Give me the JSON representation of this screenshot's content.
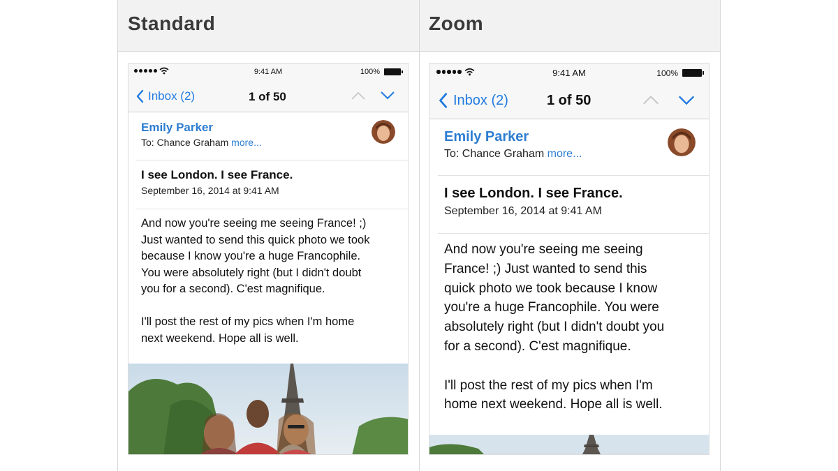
{
  "columns": {
    "standard_title": "Standard",
    "zoom_title": "Zoom"
  },
  "status": {
    "time": "9:41 AM",
    "battery": "100%"
  },
  "nav": {
    "back_label": "Inbox (2)",
    "counter": "1 of 50"
  },
  "email": {
    "sender": "Emily Parker",
    "to_prefix": "To: Chance Graham ",
    "more_link": "more...",
    "subject": "I see London. I see France.",
    "date": "September 16, 2014 at 9:41 AM"
  },
  "standard_body": {
    "lines": [
      "And now you're seeing me seeing France! ;)",
      "Just wanted to send this quick photo we took",
      "because I know you're a huge Francophile.",
      "You were absolutely right (but I didn't doubt",
      "you for a second). C'est magnifique.",
      "",
      "I'll post the rest of my pics when I'm home",
      "next weekend. Hope all is well."
    ]
  },
  "zoom_body": {
    "lines": [
      "And now you're seeing me seeing",
      "France! ;) Just wanted to send this",
      "quick photo we took because I know",
      "you're a huge Francophile. You were",
      "absolutely right (but I didn't doubt you",
      "for a second). C'est magnifique.",
      "",
      "I'll post the rest of my pics when I'm",
      "home next weekend. Hope all is well."
    ]
  },
  "colors": {
    "accent": "#1f7ae0",
    "sender": "#2c7dd1",
    "header_bg": "#f2f2f2"
  }
}
